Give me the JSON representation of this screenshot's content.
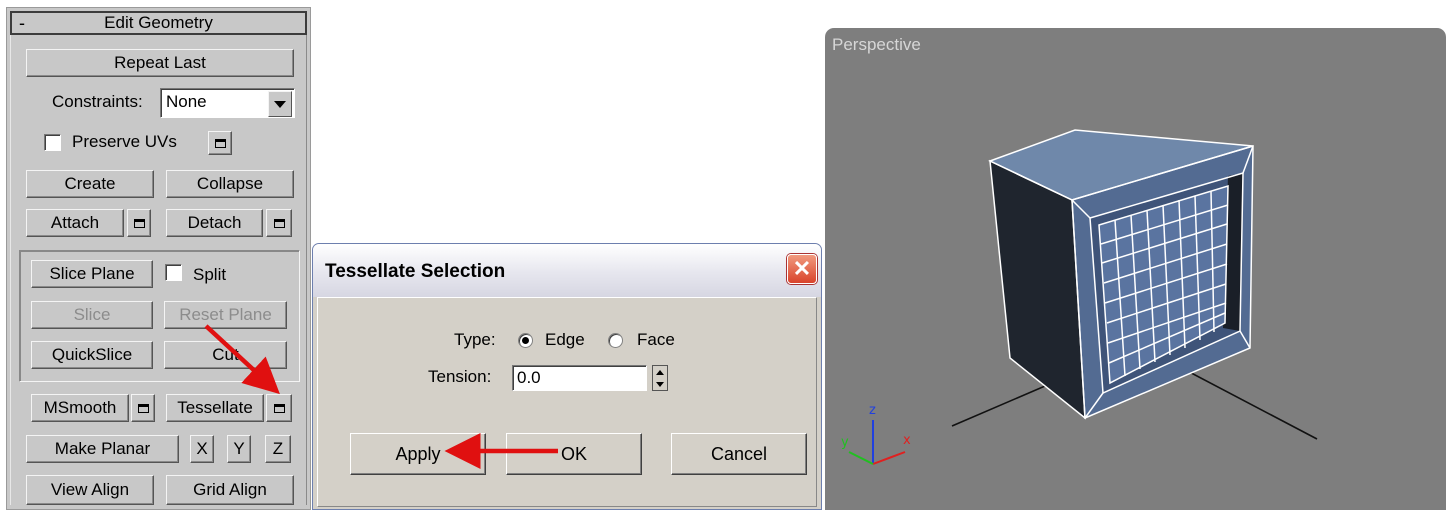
{
  "panel": {
    "rollout_title": "Edit Geometry",
    "collapse_symbol": "-",
    "repeat_last": "Repeat Last",
    "constraints_label": "Constraints:",
    "constraints_value": "None",
    "preserve_uvs": "Preserve UVs",
    "create": "Create",
    "collapse": "Collapse",
    "attach": "Attach",
    "detach": "Detach",
    "slice_plane": "Slice Plane",
    "split": "Split",
    "slice": "Slice",
    "reset_plane": "Reset Plane",
    "quickslice": "QuickSlice",
    "cut": "Cut",
    "msmooth": "MSmooth",
    "tessellate": "Tessellate",
    "make_planar": "Make Planar",
    "x": "X",
    "y": "Y",
    "z": "Z",
    "view_align": "View Align",
    "grid_align": "Grid Align"
  },
  "dialog": {
    "title": "Tessellate Selection",
    "type_label": "Type:",
    "type_options": [
      "Edge",
      "Face"
    ],
    "type_selected": "Edge",
    "tension_label": "Tension:",
    "tension_value": "0.0",
    "apply": "Apply",
    "ok": "OK",
    "cancel": "Cancel"
  },
  "viewport": {
    "label": "Perspective",
    "axes": {
      "x": "x",
      "y": "y",
      "z": "z"
    }
  },
  "annotations": {
    "arrow_color": "#e01010"
  }
}
